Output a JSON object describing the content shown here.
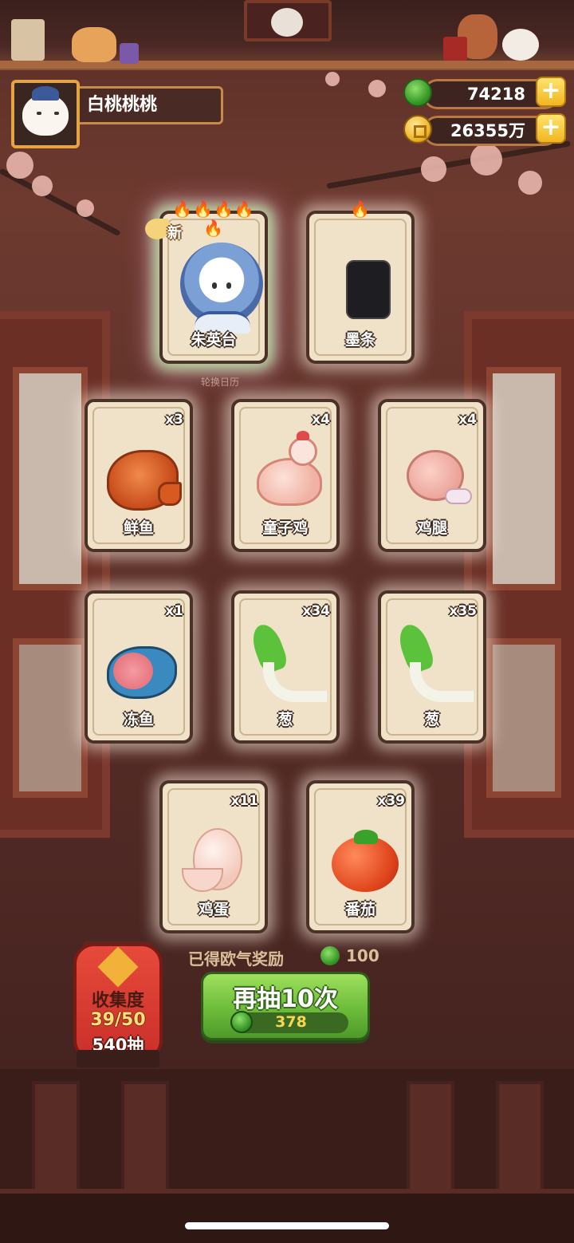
{
  "player": {
    "name": "白桃桃桃"
  },
  "currency": {
    "jade": "74218",
    "coins": "26355万",
    "plus": "+"
  },
  "calendar_label": "轮换日历",
  "cards": [
    {
      "name": "朱英台",
      "qty": "",
      "flames": "🔥🔥🔥🔥🔥",
      "new": "新",
      "special": true
    },
    {
      "name": "墨条",
      "qty": "",
      "flames": "🔥",
      "new": "",
      "special": false
    },
    {
      "name": "鲜鱼",
      "qty": "x3",
      "flames": "",
      "new": "",
      "special": false
    },
    {
      "name": "童子鸡",
      "qty": "x4",
      "flames": "",
      "new": "",
      "special": false
    },
    {
      "name": "鸡腿",
      "qty": "x4",
      "flames": "",
      "new": "",
      "special": false
    },
    {
      "name": "冻鱼",
      "qty": "x1",
      "flames": "",
      "new": "",
      "special": false
    },
    {
      "name": "葱",
      "qty": "x34",
      "flames": "",
      "new": "",
      "special": false
    },
    {
      "name": "葱",
      "qty": "x35",
      "flames": "",
      "new": "",
      "special": false
    },
    {
      "name": "鸡蛋",
      "qty": "x11",
      "flames": "",
      "new": "",
      "special": false
    },
    {
      "name": "番茄",
      "qty": "x39",
      "flames": "",
      "new": "",
      "special": false
    }
  ],
  "reward": {
    "label": "已得欧气奖励",
    "value": "100"
  },
  "draw_button": {
    "label": "再抽10次",
    "cost": "378"
  },
  "collection": {
    "title": "收集度",
    "progress": "39/50",
    "pulls": "540抽"
  },
  "colors": {
    "background": "#5a2e26",
    "card": "#efe2c8",
    "button_green": "#6cbc3a",
    "lantern_red": "#d63a30",
    "gold": "#f2b521"
  },
  "icons": {
    "jade": "jade-coin-icon",
    "coin": "gold-coin-icon",
    "plus": "plus-icon",
    "flame": "flame-icon"
  }
}
